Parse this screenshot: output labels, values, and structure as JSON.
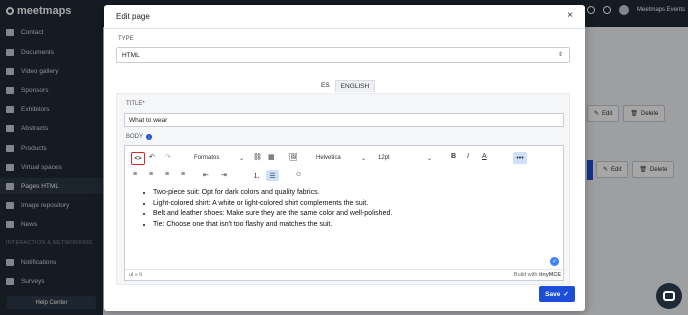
{
  "sidebar": {
    "logo": "meetmaps",
    "items": [
      {
        "label": "Contact",
        "icon": "contact-icon"
      },
      {
        "label": "Documents",
        "icon": "document-icon"
      },
      {
        "label": "Video gallery",
        "icon": "video-icon"
      },
      {
        "label": "Sponsors",
        "icon": "flag-icon"
      },
      {
        "label": "Exhibitors",
        "icon": "exhibitor-icon"
      },
      {
        "label": "Abstracts",
        "icon": "abstract-icon"
      },
      {
        "label": "Products",
        "icon": "product-icon"
      },
      {
        "label": "Virtual spaces",
        "icon": "virtual-icon"
      },
      {
        "label": "Pages HTML",
        "icon": "html-icon"
      },
      {
        "label": "Image repository",
        "icon": "image-icon"
      },
      {
        "label": "News",
        "icon": "news-icon"
      }
    ],
    "section": "INTERACTION & NETWORKING",
    "section_items": [
      {
        "label": "Notifications",
        "icon": "bell-icon"
      },
      {
        "label": "Surveys",
        "icon": "survey-icon"
      }
    ],
    "help": "Help Center"
  },
  "topbar": {
    "user": "Meetmaps Events"
  },
  "background": {
    "edit": "Edit",
    "delete": "Delete"
  },
  "modal": {
    "title": "Edit page",
    "close": "×",
    "type_label": "TYPE",
    "type_value": "HTML",
    "languages": [
      "ES",
      "ENGLISH"
    ],
    "title_label": "TITLE*",
    "title_value": "What to wear",
    "body_label": "BODY",
    "editor": {
      "formats": "Formatos",
      "font": "Helvetica",
      "size": "12pt",
      "bold": "B",
      "italic": "I",
      "color": "A",
      "items": [
        "Two-piece suit: Opt for dark colors and quality fabrics.",
        "Light-colored shirt: A white or light-colored shirt complements the suit.",
        "Belt and leather shoes: Make sure they are the same color and well-polished.",
        "Tie: Choose one that isn't too flashy and matches the suit."
      ],
      "path": "ul » li",
      "brand": "Build with",
      "brand_name": "tinyMCE"
    },
    "save": "Save"
  },
  "colors": {
    "primary": "#1d4ed8",
    "sidebar": "#1f2a37",
    "highlight": "#d62828"
  }
}
